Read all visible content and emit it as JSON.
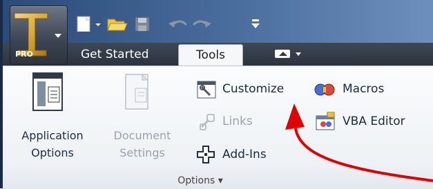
{
  "app": {
    "badge": "PRO"
  },
  "tabs": {
    "get_started": "Get Started",
    "tools": "Tools"
  },
  "ribbon": {
    "app_options": {
      "line1": "Application",
      "line2": "Options"
    },
    "doc_settings": {
      "line1": "Document",
      "line2": "Settings"
    },
    "customize": "Customize",
    "links": "Links",
    "addins": "Add-Ins",
    "macros": "Macros",
    "vba_editor": "VBA Editor",
    "group_label": "Options ▾"
  },
  "colors": {
    "arrow": "#e00000",
    "titlebar": "#3a5a88",
    "tabstrip": "#2f3844"
  }
}
